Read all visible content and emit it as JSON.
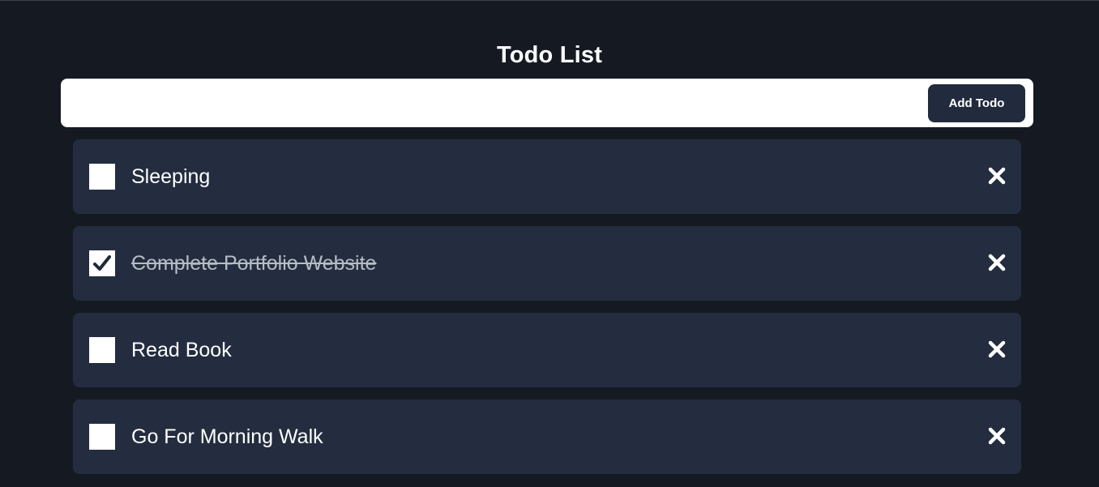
{
  "header": {
    "title": "Todo List"
  },
  "add_form": {
    "input_value": "",
    "button_label": "Add Todo"
  },
  "todos": [
    {
      "text": "Sleeping",
      "completed": false,
      "delete_icon": "close-icon"
    },
    {
      "text": "Complete Portfolio Website",
      "completed": true,
      "delete_icon": "close-icon"
    },
    {
      "text": "Read Book",
      "completed": false,
      "delete_icon": "close-icon"
    },
    {
      "text": "Go For Morning Walk",
      "completed": false,
      "delete_icon": "close-icon"
    }
  ],
  "colors": {
    "background": "#151a22",
    "card": "#232d3f",
    "button": "#222b3d",
    "text": "#ffffff",
    "completed_text": "#b7bcc5"
  }
}
